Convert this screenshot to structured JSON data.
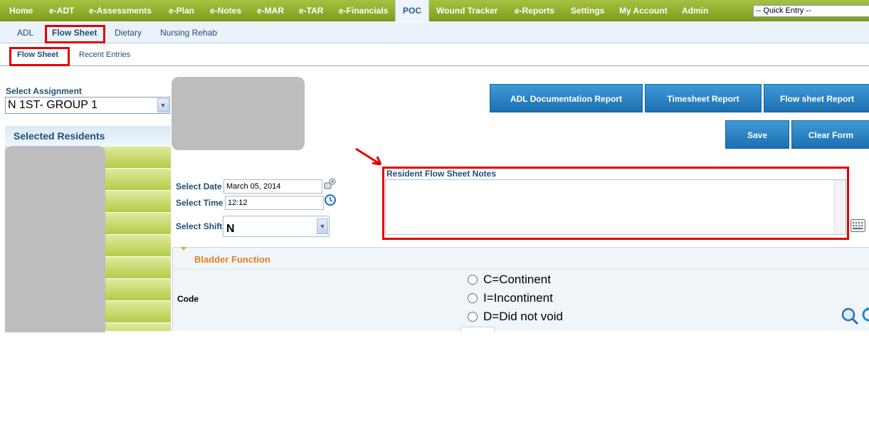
{
  "topnav": {
    "items": [
      "Home",
      "e-ADT",
      "e-Assessments",
      "e-Plan",
      "e-Notes",
      "e-MAR",
      "e-TAR",
      "e-Financials",
      "POC",
      "Wound Tracker",
      "e-Reports",
      "Settings",
      "My Account",
      "Admin"
    ],
    "active": "POC",
    "quick_entry": "-- Quick Entry --"
  },
  "subnav1": {
    "items": [
      "ADL",
      "Flow Sheet",
      "Dietary",
      "Nursing Rehab"
    ],
    "active": "Flow Sheet"
  },
  "subnav2": {
    "items": [
      "Flow Sheet",
      "Recent Entries"
    ],
    "active": "Flow Sheet"
  },
  "assignment": {
    "label": "Select Assignment",
    "value": "N 1ST- GROUP 1"
  },
  "residents": {
    "header": "Selected Residents",
    "row_count": 8
  },
  "form": {
    "date_label": "Select Date",
    "date_value": "March 05, 2014",
    "time_label": "Select Time",
    "time_value": "12:12",
    "shift_label": "Select Shift",
    "shift_value": "N"
  },
  "buttons": {
    "adl_report": "ADL Documentation Report",
    "timesheet_report": "Timesheet Report",
    "flowsheet_report": "Flow sheet Report",
    "save": "Save",
    "clear_form": "Clear Form"
  },
  "notes": {
    "label": "Resident Flow Sheet Notes",
    "value": ""
  },
  "bladder": {
    "title": "Bladder Function",
    "code_label": "Code",
    "options": [
      "C=Continent",
      "I=Incontinent",
      "D=Did not void"
    ]
  },
  "colors": {
    "nav_green": "#8aaa28",
    "brand_blue": "#1f4e79",
    "button_blue": "#2a84c6",
    "highlight_red": "#e30000",
    "section_orange": "#e4811e"
  }
}
